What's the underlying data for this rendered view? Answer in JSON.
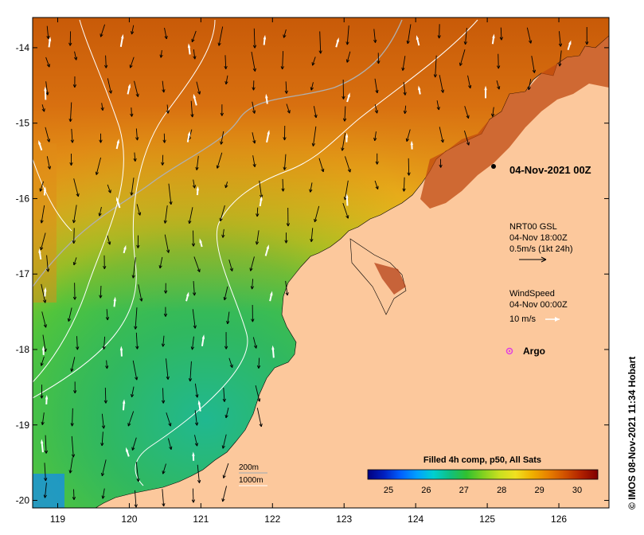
{
  "map": {
    "lon_ticks": [
      "119",
      "120",
      "121",
      "122",
      "123",
      "124",
      "125",
      "126"
    ],
    "lat_ticks": [
      "-14",
      "-15",
      "-16",
      "-17",
      "-18",
      "-19",
      "-20"
    ],
    "lon_range": [
      118.65,
      126.7
    ],
    "lat_range": [
      -13.6,
      -20.1
    ],
    "land_color": "#fcc89c",
    "date_label": "04-Nov-2021 00Z",
    "gsl": {
      "line1": "NRT00 GSL",
      "line2": "04-Nov 18:00Z",
      "line3": "0.5m/s (1kt 24h)"
    },
    "wind": {
      "line1": "WindSpeed",
      "line2": "04-Nov 00:00Z",
      "line3": "10 m/s"
    },
    "argo": {
      "label": "Argo",
      "color": "#e040e0"
    },
    "depth": {
      "d200": "200m",
      "d1000": "1000m"
    },
    "credit": "© IMOS 08-Nov-2021 11:34 Hobart"
  },
  "colorbar": {
    "title": "Filled 4h comp, p50, All Sats",
    "labels": [
      "25",
      "26",
      "27",
      "28",
      "29",
      "30"
    ],
    "colors": [
      "#00007f",
      "#0020c0",
      "#0060ff",
      "#00a0ff",
      "#00d0d0",
      "#10c080",
      "#30c030",
      "#80d020",
      "#c8e020",
      "#f0e020",
      "#f0b000",
      "#e88000",
      "#d05000",
      "#b02000",
      "#800000"
    ]
  }
}
